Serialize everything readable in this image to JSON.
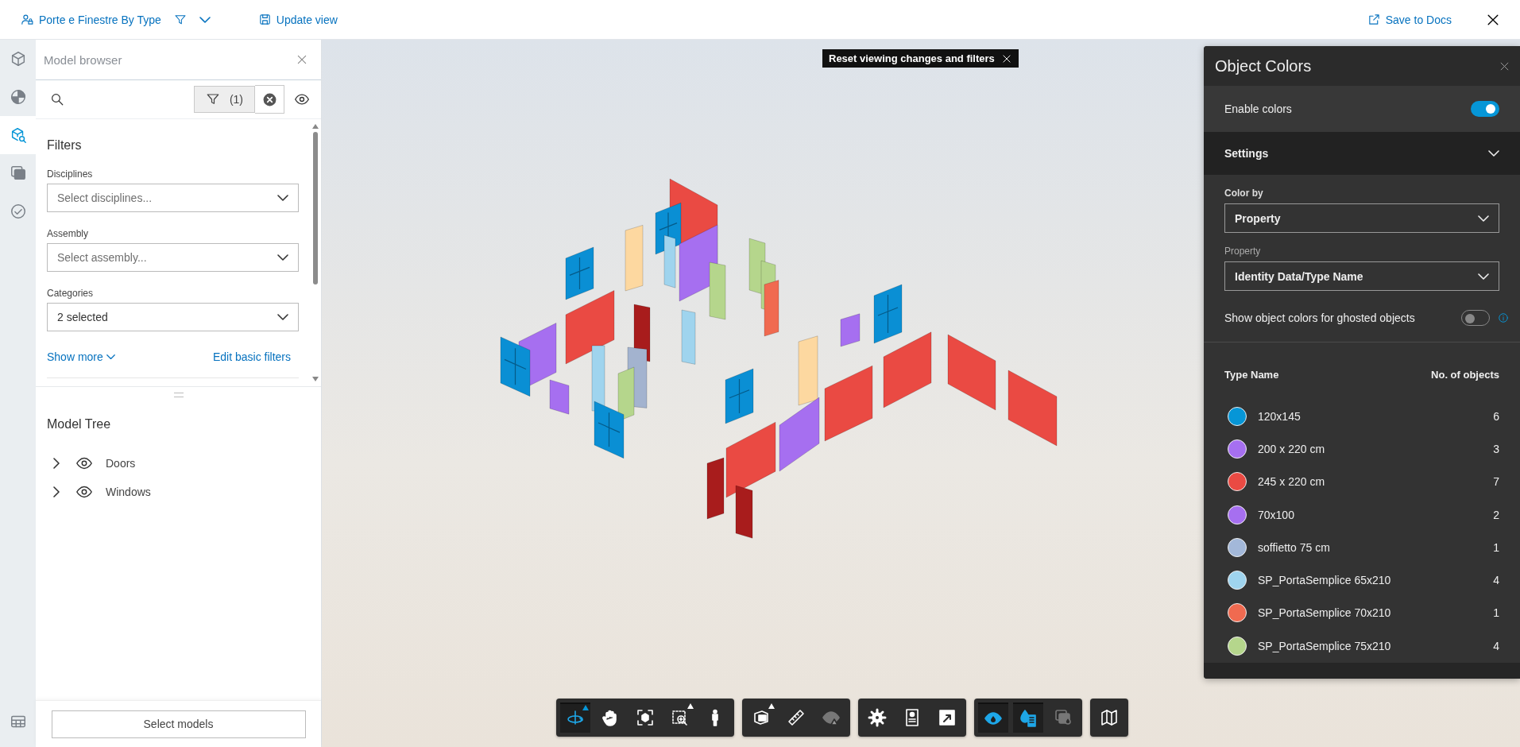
{
  "top_bar": {
    "view_name": "Porte e Finestre By Type",
    "update_view": "Update view",
    "save": "Save to Docs"
  },
  "rail": [
    {
      "kind": "cube",
      "selected": false
    },
    {
      "kind": "pie",
      "selected": false
    },
    {
      "kind": "search-cube",
      "selected": true
    },
    {
      "kind": "layers",
      "selected": false
    },
    {
      "kind": "check",
      "selected": false
    },
    {
      "kind": "table",
      "selected": false
    }
  ],
  "model_browser": {
    "title": "Model browser",
    "filter_count": "(1)",
    "filters_title": "Filters",
    "fields": [
      {
        "label": "Disciplines",
        "placeholder": "Select disciplines..."
      },
      {
        "label": "Assembly",
        "placeholder": "Select assembly..."
      },
      {
        "label": "Categories",
        "value": "2 selected"
      }
    ],
    "show_more": "Show more",
    "edit_filters": "Edit basic filters",
    "tree_title": "Model Tree",
    "tree": [
      {
        "label": "Doors",
        "expanded": false,
        "visible": true
      },
      {
        "label": "Windows",
        "expanded": false,
        "visible": true
      }
    ],
    "select_models": "Select models"
  },
  "reset_chip": "Reset viewing changes and filters",
  "object_colors": {
    "title": "Object Colors",
    "enable_colors": {
      "label": "Enable colors",
      "on": true
    },
    "settings": {
      "label": "Settings",
      "expanded": true
    },
    "color_by": {
      "label": "Color by",
      "value": "Property"
    },
    "property": {
      "label": "Property",
      "value": "Identity Data/Type Name"
    },
    "ghosted": {
      "label": "Show object colors for ghosted objects",
      "on": false
    },
    "columns": [
      "Type Name",
      "No. of objects"
    ],
    "items": [
      {
        "name": "120x145",
        "count": "6",
        "color": "#0696d7"
      },
      {
        "name": "200 x 220 cm",
        "count": "3",
        "color": "#a66ff0"
      },
      {
        "name": "245 x 220 cm",
        "count": "7",
        "color": "#ea4a43"
      },
      {
        "name": "70x100",
        "count": "2",
        "color": "#a66ff0"
      },
      {
        "name": "soffietto 75 cm",
        "count": "1",
        "color": "#a3b8d9"
      },
      {
        "name": "SP_PortaSemplice 65x210",
        "count": "4",
        "color": "#9fd4ee"
      },
      {
        "name": "SP_PortaSemplice 70x210",
        "count": "1",
        "color": "#f06a50"
      },
      {
        "name": "SP_PortaSemplice 75x210",
        "count": "4",
        "color": "#b5d68c"
      }
    ]
  },
  "toolbar": [
    [
      {
        "kind": "orbit",
        "selected": true,
        "flyout": true,
        "disabled": false
      },
      {
        "kind": "pan",
        "selected": false,
        "flyout": false,
        "disabled": false
      },
      {
        "kind": "fit",
        "selected": false,
        "flyout": false,
        "disabled": false
      },
      {
        "kind": "zoom-window",
        "selected": false,
        "flyout": true,
        "disabled": false
      },
      {
        "kind": "person",
        "selected": false,
        "flyout": false,
        "disabled": false
      }
    ],
    [
      {
        "kind": "section",
        "selected": false,
        "flyout": true,
        "disabled": false
      },
      {
        "kind": "measure",
        "selected": false,
        "flyout": false,
        "disabled": false
      },
      {
        "kind": "ghost",
        "selected": false,
        "flyout": false,
        "disabled": true
      }
    ],
    [
      {
        "kind": "settings",
        "selected": false,
        "flyout": false,
        "disabled": false
      },
      {
        "kind": "properties",
        "selected": false,
        "flyout": false,
        "disabled": false
      },
      {
        "kind": "fullscreen",
        "selected": false,
        "flyout": false,
        "disabled": false
      }
    ],
    [
      {
        "kind": "eye-drop",
        "selected": true,
        "flyout": false,
        "disabled": false
      },
      {
        "kind": "color-list",
        "selected": true,
        "flyout": false,
        "disabled": false
      },
      {
        "kind": "layer-drop",
        "selected": false,
        "flyout": false,
        "disabled": true
      }
    ],
    [
      {
        "kind": "map",
        "selected": false,
        "flyout": false,
        "disabled": false
      }
    ]
  ]
}
